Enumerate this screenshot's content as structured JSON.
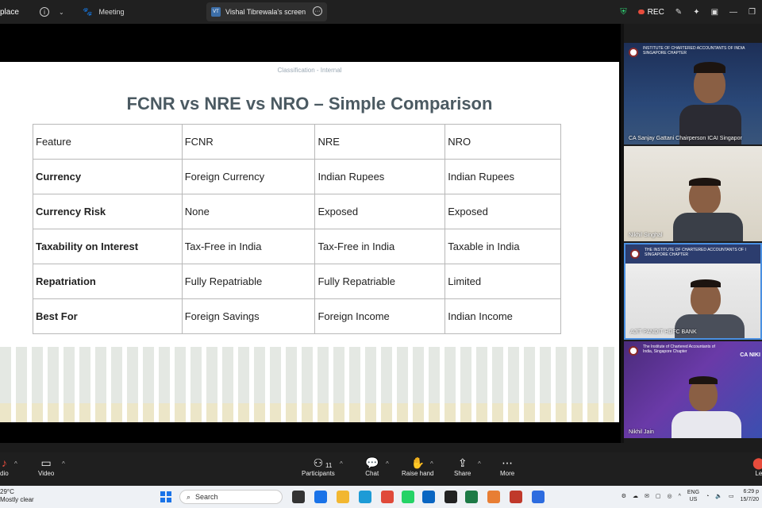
{
  "topbar": {
    "app_title": "place",
    "tabs": [
      {
        "label": "Meeting"
      },
      {
        "label": "Vishal Tibrewala's screen",
        "initials": "VT"
      }
    ],
    "rec_label": "REC"
  },
  "slide": {
    "classification": "Classification - Internal",
    "title": "FCNR vs NRE vs NRO – Simple Comparison",
    "table": {
      "header": [
        "Feature",
        "FCNR",
        "NRE",
        "NRO"
      ],
      "rows": [
        [
          "Currency",
          "Foreign Currency",
          "Indian Rupees",
          "Indian Rupees"
        ],
        [
          "Currency Risk",
          "None",
          "Exposed",
          "Exposed"
        ],
        [
          "Taxability on Interest",
          "Tax-Free in India",
          "Tax-Free in India",
          "Taxable in India"
        ],
        [
          "Repatriation",
          "Fully Repatriable",
          "Fully Repatriable",
          "Limited"
        ],
        [
          "Best For",
          "Foreign Savings",
          "Foreign Income",
          "Indian Income"
        ]
      ]
    }
  },
  "participants": [
    {
      "name": "CA Sanjay Gattani Chairperson ICAI Singapor",
      "banner": "INSTITUTE OF CHARTERED ACCOUNTANTS OF INDIA SINGAPORE CHAPTER"
    },
    {
      "name": "Nikhil Singhal",
      "banner": ""
    },
    {
      "name": "AJIT PANDIT HDFC BANK",
      "banner": "THE INSTITUTE OF CHARTERED ACCOUNTANTS OF I SINGAPORE CHAPTER"
    },
    {
      "name": "Nikhil Jain",
      "banner": "The Institute of Chartered Accountants of India, Singapore Chapter",
      "banner_right": "CA NIKI"
    }
  ],
  "toolbar": {
    "audio_label": "dio",
    "video_label": "Video",
    "participants_label": "Participants",
    "participants_count": "11",
    "chat_label": "Chat",
    "raise_hand_label": "Raise hand",
    "share_label": "Share",
    "more_label": "More",
    "leave_label": "Le"
  },
  "taskbar": {
    "weather_temp": "29°C",
    "weather_desc": "Mostly clear",
    "search_placeholder": "Search",
    "lang_1": "ENG",
    "lang_2": "US",
    "time": "6:29 p",
    "date": "15/7/20"
  }
}
